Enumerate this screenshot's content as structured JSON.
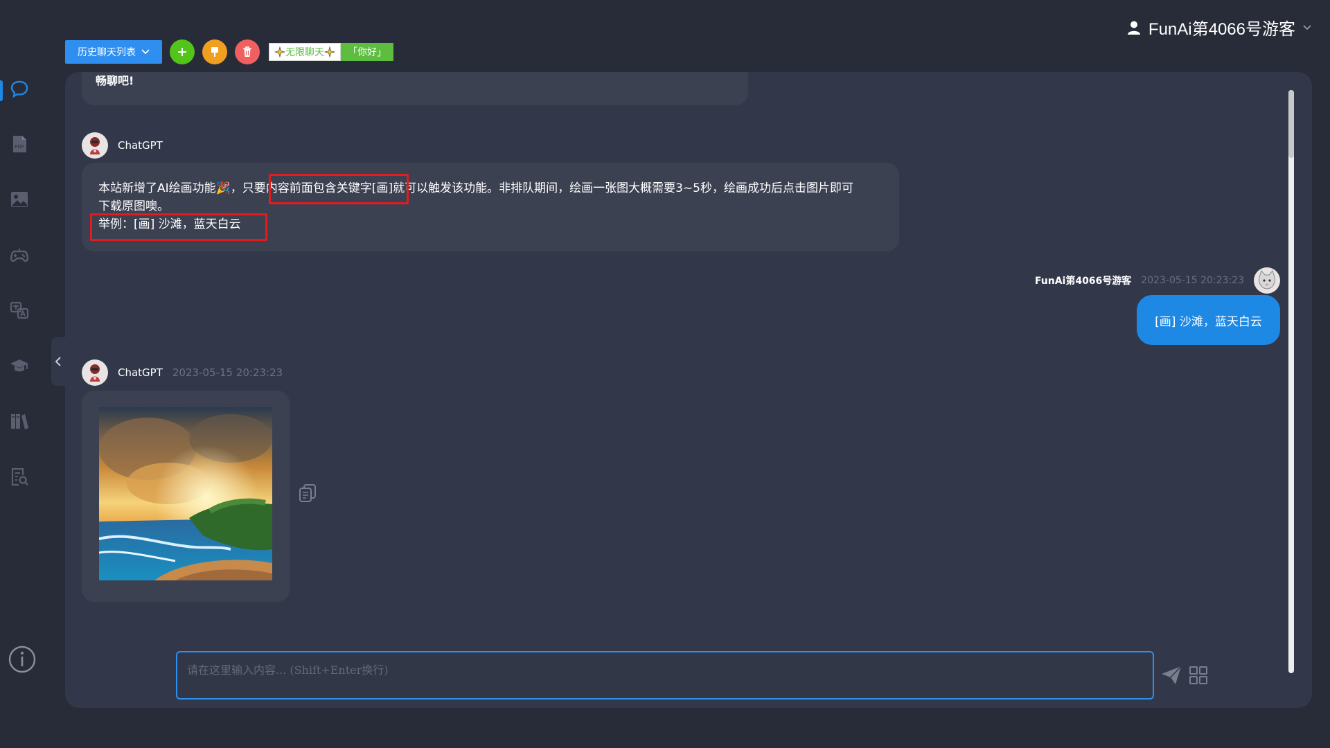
{
  "header": {
    "user_name": "FunAi第4066号游客",
    "history_label": "历史聊天列表",
    "tag_unlimited": "无限聊天",
    "tag_hello": "「你好」"
  },
  "sidebar": {
    "items": [
      "chat-icon",
      "pdf-icon",
      "image-icon",
      "gamepad-icon",
      "translate-icon",
      "graduation-icon",
      "library-icon",
      "document-search-icon"
    ],
    "info_icon": "info-icon"
  },
  "chat": {
    "top_partial_text": "畅聊吧!",
    "msg1": {
      "sender": "ChatGPT",
      "line1": "本站新增了AI绘画功能🎉，只要内容前面包含关键字[画]就可以触发该功能。非排队期间，绘画一张图大概需要3~5秒，绘画成功后点击图片即可",
      "line2": "下载原图噢。",
      "line3": "举例：[画] 沙滩，蓝天白云"
    },
    "msg2": {
      "sender": "FunAi第4066号游客",
      "time": "2023-05-15 20:23:23",
      "text": "[画] 沙滩，蓝天白云"
    },
    "msg3": {
      "sender": "ChatGPT",
      "time": "2023-05-15 20:23:23",
      "image_desc": "beach-painting"
    }
  },
  "input": {
    "placeholder": "请在这里输入内容... (Shift+Enter换行)",
    "value": ""
  },
  "colors": {
    "accent": "#2f8ff0",
    "user_bubble": "#1e88e5",
    "panel": "#32374a",
    "highlight": "#e21c1c"
  }
}
